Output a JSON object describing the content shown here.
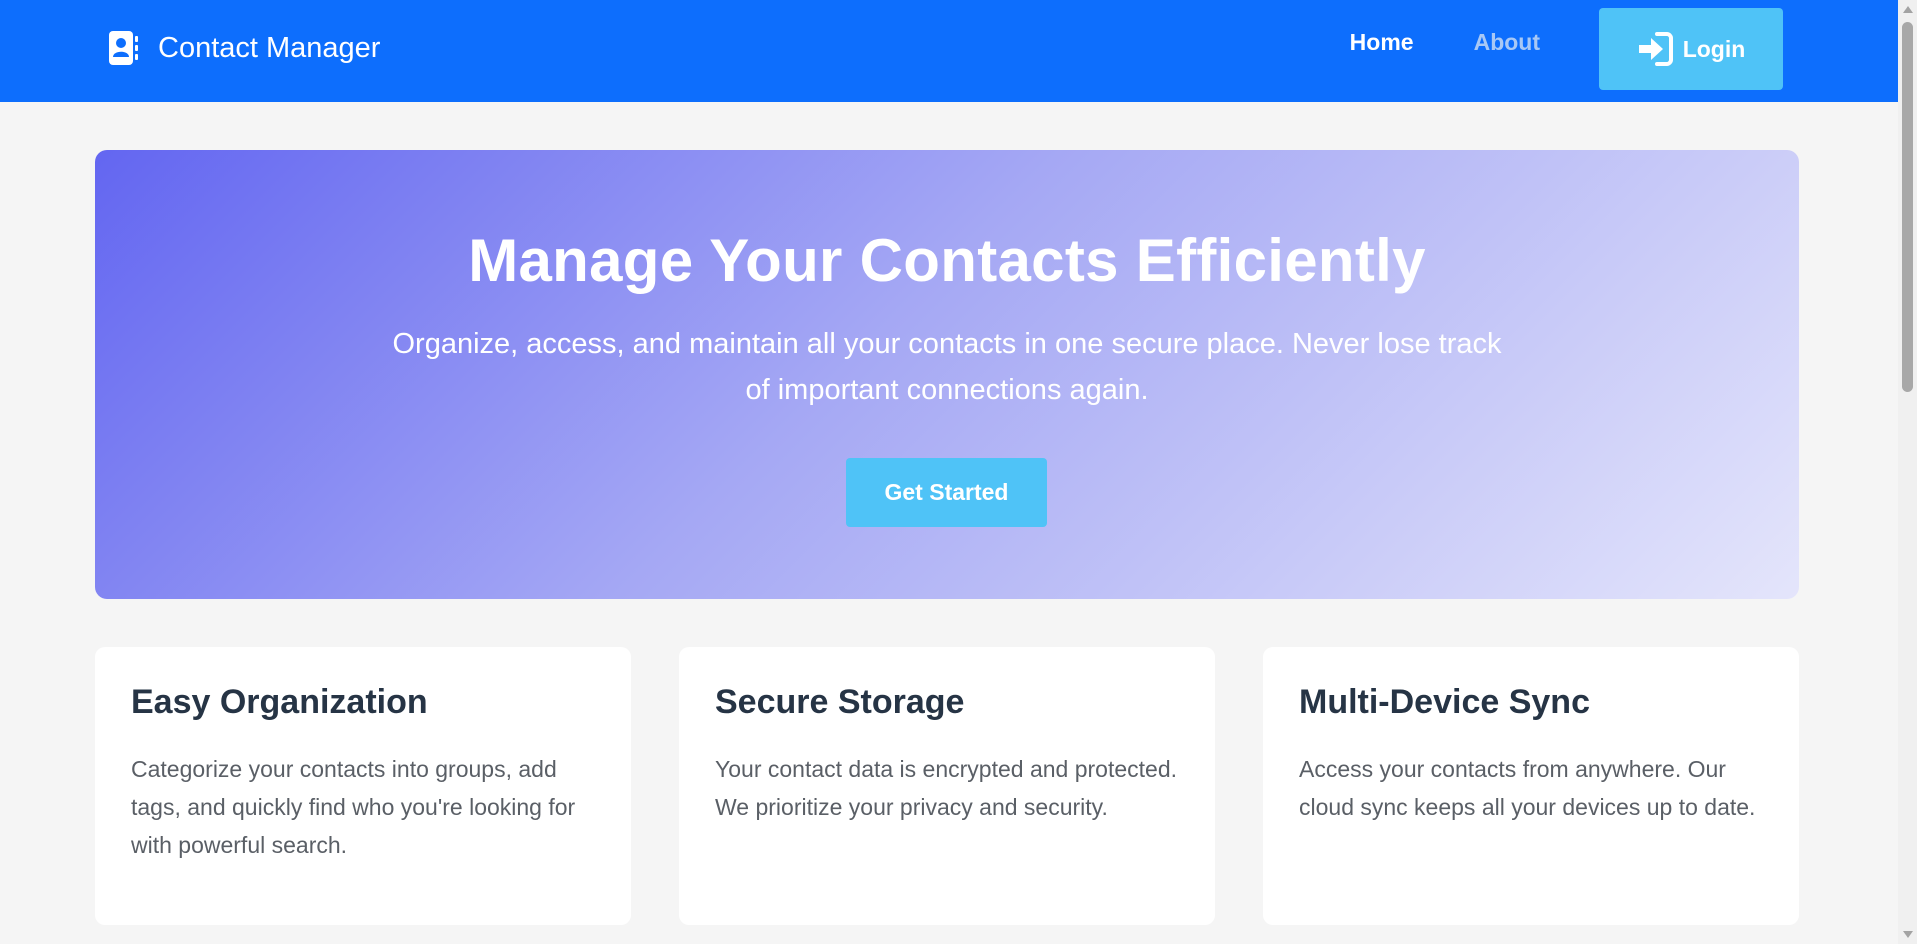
{
  "navbar": {
    "brand_icon": "address-book-icon",
    "brand_label": "Contact Manager",
    "links": [
      {
        "label": "Home"
      },
      {
        "label": "About"
      }
    ],
    "login_icon": "sign-in-icon",
    "login_label": "Login"
  },
  "hero": {
    "title": "Manage Your Contacts Efficiently",
    "subtitle": "Organize, access, and maintain all your contacts in one secure place. Never lose track of important connections again.",
    "cta_label": "Get Started"
  },
  "features": [
    {
      "title": "Easy Organization",
      "description": "Categorize your contacts into groups, add tags, and quickly find who you're looking for with powerful search."
    },
    {
      "title": "Secure Storage",
      "description": "Your contact data is encrypted and protected. We prioritize your privacy and security."
    },
    {
      "title": "Multi-Device Sync",
      "description": "Access your contacts from anywhere. Our cloud sync keeps all your devices up to date."
    }
  ],
  "colors": {
    "navbar": "#0d6efd",
    "accent_button": "#4fc3f7",
    "hero_gradient_start": "#6366f1",
    "hero_gradient_end": "#e4e5fb",
    "page_background": "#f5f5f5"
  }
}
